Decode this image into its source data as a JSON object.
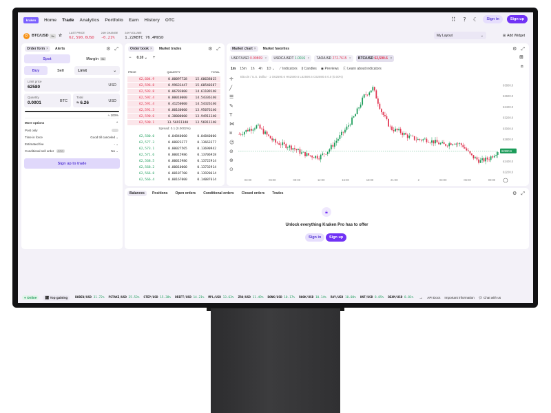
{
  "nav": {
    "logo": "kraken",
    "items": [
      "Home",
      "Trade",
      "Analytics",
      "Portfolio",
      "Earn",
      "History",
      "OTC"
    ],
    "sign_in": "Sign in",
    "sign_up": "Sign up"
  },
  "ticker": {
    "pair": "BTC/USD",
    "badge": "5x",
    "pair_price": "62,590.6USD",
    "last_price_label": "LAST PRICE",
    "last_price": "62,590.6",
    "change_label": "24H CHANGE",
    "change": "-0.21%",
    "volume_label": "24H VOLUME",
    "volume": "1.22KBTC 76.4MUSD",
    "layout": "My Layout",
    "add_widget": "Add Widget"
  },
  "order_form": {
    "tabs": [
      "Order form",
      "Alerts"
    ],
    "spot": "Spot",
    "margin": "Margin",
    "margin_badge": "5x",
    "buy": "Buy",
    "sell": "Sell",
    "order_type": "Limit",
    "limit_price_label": "Limit price",
    "limit_price": "62580",
    "limit_price_unit": "USD",
    "quantity_label": "Quantity",
    "quantity": "0.0001",
    "quantity_unit": "BTC",
    "total_label": "Total",
    "total": "≈ 6.26",
    "total_unit": "USD",
    "slider_pct": "≈ 100%",
    "more_options": "More options",
    "options": [
      {
        "label": "Post only",
        "value": ""
      },
      {
        "label": "Time in force",
        "value": "Good till canceled"
      },
      {
        "label": "Estimated fee",
        "value": "-"
      },
      {
        "label": "Conditional sell order",
        "value": "No"
      }
    ],
    "otc_badge": "OTO",
    "cta": "Sign up to trade"
  },
  "order_book": {
    "tabs": [
      "Order book",
      "Market trades"
    ],
    "tick_size": "0.10",
    "headers": [
      "PRICE",
      "QUANTITY",
      "TOTAL"
    ],
    "asks": [
      [
        "62,604.9",
        "0.00097728",
        "15.60638015"
      ],
      [
        "62,596.8",
        "0.99631447",
        "15.60540387"
      ],
      [
        "62,593.8",
        "0.06783000",
        "14.61109140"
      ],
      [
        "62,592.4",
        "0.00010000",
        "14.54336140"
      ],
      [
        "62,591.4",
        "0.41250000",
        "14.54326140"
      ],
      [
        "62,591.3",
        "0.00160000",
        "13.95076140"
      ],
      [
        "62,590.6",
        "0.38000000",
        "13.94911140"
      ],
      [
        "62,590.1",
        "13.56911140",
        "13.56911140"
      ]
    ],
    "spread": "Spread: 0.1 (0.0002%)",
    "bids": [
      [
        "62,580.0",
        "0.04840000",
        "0.04840000"
      ],
      [
        "62,577.3",
        "0.08823377",
        "0.13663377"
      ],
      [
        "62,573.1",
        "0.00027565",
        "0.13690942"
      ],
      [
        "62,571.6",
        "0.00015986",
        "0.13706928"
      ],
      [
        "62,568.5",
        "0.00015986",
        "0.13722914"
      ],
      [
        "62,568.2",
        "0.00010000",
        "0.13732914"
      ],
      [
        "62,566.8",
        "0.00187700",
        "0.13920614"
      ],
      [
        "62,566.4",
        "0.00167000",
        "0.14087614"
      ]
    ]
  },
  "chart": {
    "tabs": [
      "Market chart",
      "Market favorites"
    ],
    "symbols": [
      {
        "pair": "USDT/USD",
        "price": "0.99869"
      },
      {
        "pair": "USDC/USDT",
        "price": "1.0016"
      },
      {
        "pair": "TAO/USD",
        "price": "272.7615"
      },
      {
        "pair": "BTC/USD",
        "price": "62,590.6"
      }
    ],
    "intervals": [
      "1m",
      "15m",
      "1h",
      "4h",
      "1D"
    ],
    "tools": [
      "Indicators",
      "Candles",
      "Previews",
      "Learn about indicators"
    ],
    "legend": "Bitcoin / U.S. Dollar · 1  O62590.6 H62590.6 L62590.6 C62590.6  0.0 (0.00%)",
    "time_labels": [
      "03:00",
      "06:00",
      "09:00",
      "12:00",
      "15:00",
      "18:00",
      "21:00",
      "2",
      "03:00",
      "06:00",
      "09:00"
    ],
    "price_labels": [
      "63800.0",
      "63600.0",
      "63400.0",
      "63200.0",
      "63000.0",
      "62800.0",
      "62590.6",
      "62400.0",
      "62200.0"
    ],
    "current_price": "62590.6",
    "colors": {
      "up": "#1c9c5a",
      "down": "#e0334f"
    }
  },
  "balances": {
    "tabs": [
      "Balances",
      "Positions",
      "Open orders",
      "Conditional orders",
      "Closed orders",
      "Trades"
    ],
    "message": "Unlock everything Kraken Pro has to offer",
    "sign_in": "Sign in",
    "sign_up": "Sign up"
  },
  "footer": {
    "online": "Online",
    "top_gaining": "Top gaining",
    "movers": [
      {
        "pair": "BODEN/USD",
        "pct": "31.72%"
      },
      {
        "pair": "PSTAKE/USD",
        "pct": "25.53%"
      },
      {
        "pair": "STEP/USD",
        "pct": "15.38%"
      },
      {
        "pair": "DRIFT/USD",
        "pct": "14.21%"
      },
      {
        "pair": "MPL/USD",
        "pct": "13.63%"
      },
      {
        "pair": "ZRO/USD",
        "pct": "11.49%"
      },
      {
        "pair": "BONK/USD",
        "pct": "10.17%"
      },
      {
        "pair": "ROOK/USD",
        "pct": "10.14%"
      },
      {
        "pair": "RAY/USD",
        "pct": "10.00%"
      },
      {
        "pair": "HNT/USD",
        "pct": "8.85%"
      },
      {
        "pair": "BEAM/USD",
        "pct": "8.81%"
      }
    ],
    "api_docs": "API Docs",
    "important": "Important information",
    "chat": "Chat with us"
  }
}
